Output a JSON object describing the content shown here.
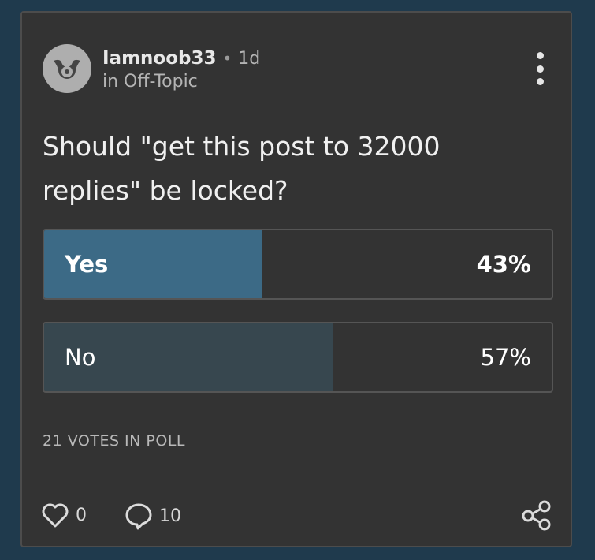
{
  "post": {
    "author": "Iamnoob33",
    "separator": "•",
    "time": "1d",
    "category": "in Off-Topic",
    "title": "Should \"get this post to 32000 replies\" be locked?"
  },
  "poll": {
    "options": [
      {
        "label": "Yes",
        "percent_text": "43%",
        "percent": 43,
        "fill_color": "#3c6a86"
      },
      {
        "label": "No",
        "percent_text": "57%",
        "percent": 57,
        "fill_color": "#37474f"
      }
    ],
    "votes_text": "21 VOTES IN POLL"
  },
  "footer": {
    "likes": "0",
    "comments": "10"
  },
  "icons": {
    "avatar": "avatar-icon",
    "menu": "more-vertical-icon",
    "like": "heart-icon",
    "comment": "comment-bubble-icon",
    "share": "share-icon"
  },
  "colors": {
    "page_background": "#1f3a4d",
    "card_background": "#333333",
    "yes_fill": "#3c6a86",
    "no_fill": "#37474f"
  }
}
